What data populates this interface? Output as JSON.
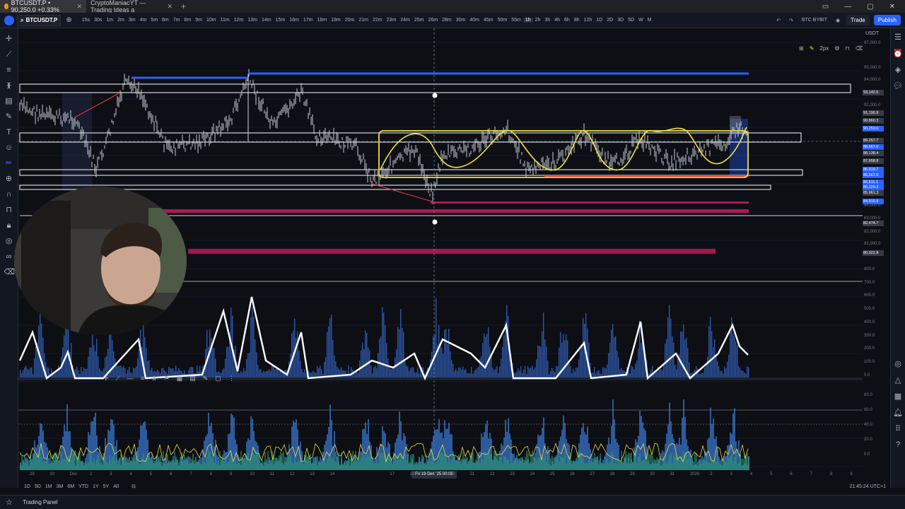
{
  "browser": {
    "tab1_title": "BTCUSDT.P • 90,250.0 +0.33%",
    "tab2_title": "CryptoManiacYT — Trading Ideas a",
    "new_tab": "+",
    "controls": [
      "▭",
      "—",
      "▢",
      "✕"
    ]
  },
  "toolbar": {
    "symbol": "BTCUSDT.P",
    "intervals": [
      "15s",
      "30s",
      "1m",
      "2m",
      "3m",
      "4m",
      "5m",
      "6m",
      "7m",
      "8m",
      "9m",
      "10m",
      "11m",
      "12m",
      "13m",
      "14m",
      "15m",
      "16m",
      "17m",
      "18m",
      "19m",
      "20m",
      "21m",
      "22m",
      "23m",
      "24m",
      "25m",
      "26m",
      "28m",
      "30m",
      "40m",
      "45m",
      "50m",
      "55m",
      "1h",
      "2h",
      "3h",
      "4h",
      "6h",
      "8h",
      "12h",
      "1D",
      "2D",
      "3D",
      "5D",
      "W",
      "M"
    ],
    "selected_interval": "1h",
    "exchange": "BTC BYBIT",
    "trade_label": "Trade",
    "publish_label": "Publish"
  },
  "drawing_toolbar": {
    "width_label": "2px"
  },
  "price_axis": {
    "currency": "USDT",
    "labels": [
      "97,000.0",
      "95,000.0",
      "94,000.0",
      "93,142.5",
      "92,000.0",
      "91,190.9",
      "90,860.3",
      "90,250.0",
      "89,257.7",
      "88,667.0",
      "88,138.4",
      "87,958.8",
      "86,919.7",
      "86,667.0",
      "86,611.1",
      "86,329.3",
      "85,961.3",
      "84,915.9",
      "84,000.0",
      "83,000.0",
      "82,474.7",
      "82,000.0",
      "81,000.0",
      "80,321.8"
    ],
    "osc1_labels": [
      "800.0",
      "700.0",
      "600.0",
      "500.0",
      "400.0",
      "300.0",
      "200.0",
      "100.0",
      "0.0"
    ],
    "osc2_labels": [
      "80.0",
      "60.0",
      "40.0",
      "20.0",
      "0.0"
    ],
    "tags": [
      {
        "text": "93,142.5",
        "color": "#363a45"
      },
      {
        "text": "91,190.9",
        "color": "#363a45"
      },
      {
        "text": "90,860.3",
        "color": "#363a45"
      },
      {
        "text": "90,250.0",
        "color": "#2962ff"
      },
      {
        "text": "89,257.7",
        "color": "#363a45"
      },
      {
        "text": "88,667.0",
        "color": "#2962ff"
      },
      {
        "text": "88,138.4",
        "color": "#363a45"
      },
      {
        "text": "87,958.8",
        "color": "#363a45"
      },
      {
        "text": "86,919.7",
        "color": "#2962ff"
      },
      {
        "text": "86,667.0",
        "color": "#2962ff"
      },
      {
        "text": "86,611.1",
        "color": "#2962ff"
      },
      {
        "text": "86,329.3",
        "color": "#2962ff"
      },
      {
        "text": "85,961.3",
        "color": "#363a45"
      },
      {
        "text": "84,915.9",
        "color": "#2962ff"
      },
      {
        "text": "82,474.7",
        "color": "#363a45"
      },
      {
        "text": "80,321.8",
        "color": "#363a45"
      }
    ]
  },
  "time_axis": {
    "ticks": [
      "29",
      "30",
      "Dec",
      "2",
      "3",
      "4",
      "5",
      "6",
      "7",
      "8",
      "9",
      "10",
      "11",
      "12",
      "13",
      "14",
      "15",
      "16",
      "17",
      "18",
      "19",
      "20",
      "21",
      "22",
      "23",
      "24",
      "25",
      "26",
      "27",
      "28",
      "29",
      "30",
      "31",
      "2026",
      "2",
      "3",
      "4",
      "5",
      "6",
      "7",
      "8",
      "9"
    ],
    "cursor_label": "Fri 19 Dec '25   00:00"
  },
  "bottom": {
    "ranges": [
      "1D",
      "5D",
      "1M",
      "3M",
      "6M",
      "YTD",
      "1Y",
      "5Y",
      "All"
    ],
    "time": "21:45:24 UTC+1",
    "panel_label": "Trading Panel"
  },
  "colors": {
    "bg": "#0d0f14",
    "box_yellow": "#f0e040",
    "line_blue": "#2962ff",
    "line_red": "#f23645",
    "zone_white": "#d1d4dc"
  }
}
